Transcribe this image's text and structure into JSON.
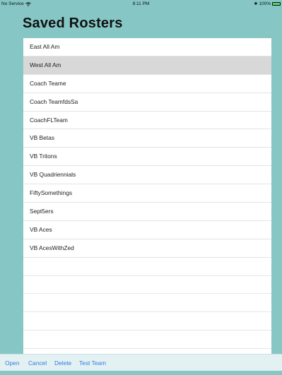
{
  "status_bar": {
    "carrier": "No Service",
    "time": "8:11 PM",
    "battery": "100%",
    "battery_level": 1.0,
    "wifi_icon": "wifi-icon",
    "bluetooth_icon": "bluetooth-icon",
    "battery_icon": "battery-icon"
  },
  "header": {
    "title": "Saved Rosters"
  },
  "rosters": {
    "items": [
      {
        "label": "East All Am",
        "selected": false
      },
      {
        "label": "West All Am",
        "selected": true
      },
      {
        "label": "Coach Teame",
        "selected": false
      },
      {
        "label": "Coach TeamfdsSa",
        "selected": false
      },
      {
        "label": "CoachFLTeam",
        "selected": false
      },
      {
        "label": "VB Betas",
        "selected": false
      },
      {
        "label": "VB Tritons",
        "selected": false
      },
      {
        "label": "VB Quadriennials",
        "selected": false
      },
      {
        "label": "FiftySomethings",
        "selected": false
      },
      {
        "label": "Sept5ers",
        "selected": false
      },
      {
        "label": "VB Aces",
        "selected": false
      },
      {
        "label": "VB AcesWithZed",
        "selected": false
      }
    ],
    "empty_rows": 5
  },
  "toolbar": {
    "open_label": "Open",
    "cancel_label": "Cancel",
    "delete_label": "Delete",
    "test_team_label": "Test Team"
  },
  "colors": {
    "background": "#86c7c6",
    "selected_row": "#d8d8d8",
    "toolbar_bg": "#e4f1f3",
    "accent": "#2f7de1",
    "battery_fill": "#4cd964"
  }
}
